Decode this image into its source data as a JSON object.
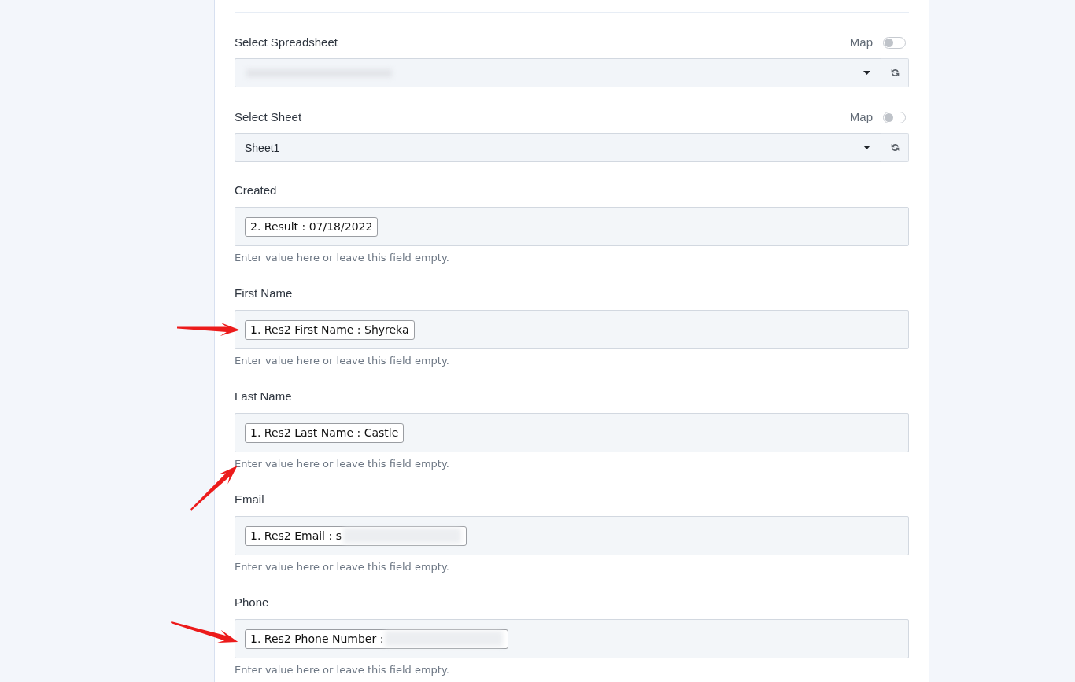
{
  "selects": [
    {
      "label": "Select Spreadsheet",
      "map_label": "Map",
      "map_on": false,
      "redacted": true
    },
    {
      "label": "Select Sheet",
      "map_label": "Map",
      "map_on": false,
      "value": "Sheet1"
    }
  ],
  "fields": [
    {
      "label": "Created",
      "chip": "2. Result : 07/18/2022",
      "hint": "Enter value here or leave this field empty."
    },
    {
      "label": "First Name",
      "chip": "1. Res2 First Name : Shyreka",
      "hint": "Enter value here or leave this field empty.",
      "arrow": {
        "kind": "flat"
      }
    },
    {
      "label": "Last Name",
      "chip": "1. Res2 Last Name : Castle",
      "hint": "Enter value here or leave this field empty.",
      "arrow": {
        "kind": "rising"
      }
    },
    {
      "label": "Email",
      "chip": "1. Res2 Email : s",
      "redacted": true,
      "hint": "Enter value here or leave this field empty."
    },
    {
      "label": "Phone",
      "chip": "1. Res2 Phone Number :",
      "redacted": true,
      "hint": "Enter value here or leave this field empty.",
      "arrow": {
        "kind": "falling"
      }
    }
  ]
}
